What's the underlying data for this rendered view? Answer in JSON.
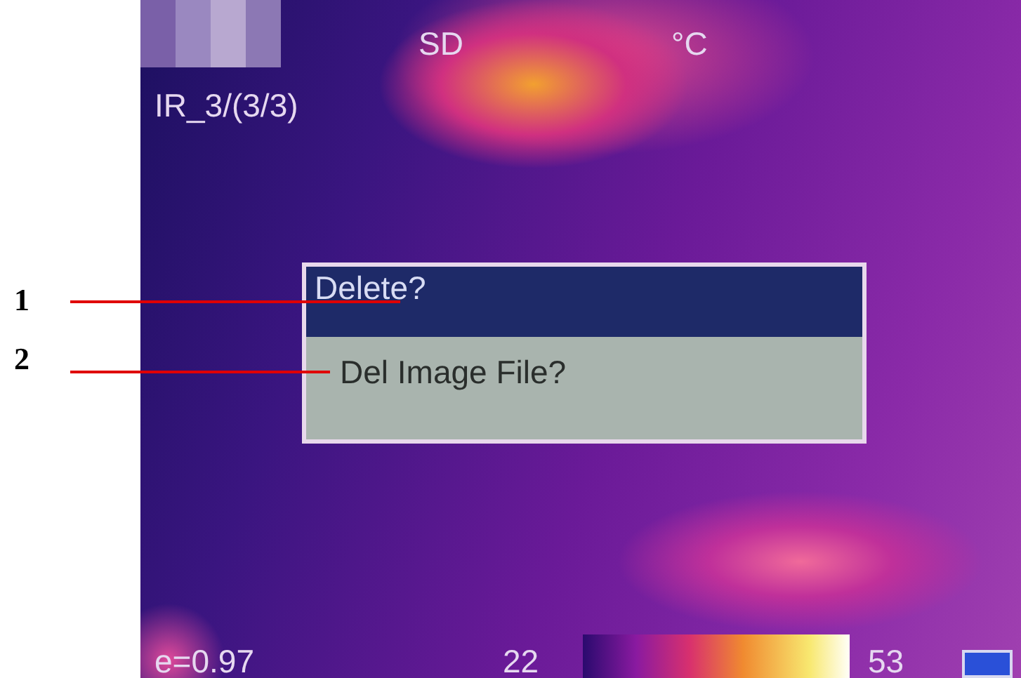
{
  "callouts": [
    {
      "label": "1"
    },
    {
      "label": "2"
    }
  ],
  "screen": {
    "storage": "SD",
    "unit": "°C",
    "file": "IR_3/(3/3)",
    "dialog": {
      "title": "Delete?",
      "message": "Del Image File?"
    },
    "emissivity": "e=0.97",
    "scale_min": "22",
    "scale_max": "53"
  }
}
